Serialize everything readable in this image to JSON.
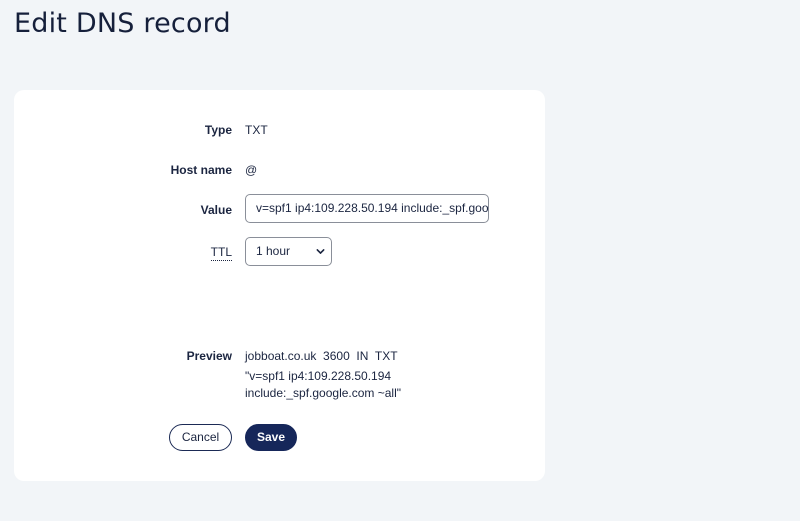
{
  "page": {
    "title": "Edit DNS record"
  },
  "form": {
    "type": {
      "label": "Type",
      "value": "TXT"
    },
    "host": {
      "label": "Host name",
      "value": "@"
    },
    "value": {
      "label": "Value",
      "input_value": "v=spf1 ip4:109.228.50.194 include:_spf.google.com ~all"
    },
    "ttl": {
      "label": "TTL",
      "selected": "1 hour"
    },
    "preview": {
      "label": "Preview",
      "line1": "jobboat.co.uk  3600  IN  TXT",
      "line2": "\"v=spf1 ip4:109.228.50.194",
      "line3": "include:_spf.google.com ~all\""
    }
  },
  "actions": {
    "cancel_label": "Cancel",
    "save_label": "Save"
  },
  "colors": {
    "background": "#f2f5f8",
    "card": "#ffffff",
    "primary": "#16275a",
    "text": "#1b2540"
  },
  "icons": {
    "select_chevron": "chevron-down-icon"
  }
}
